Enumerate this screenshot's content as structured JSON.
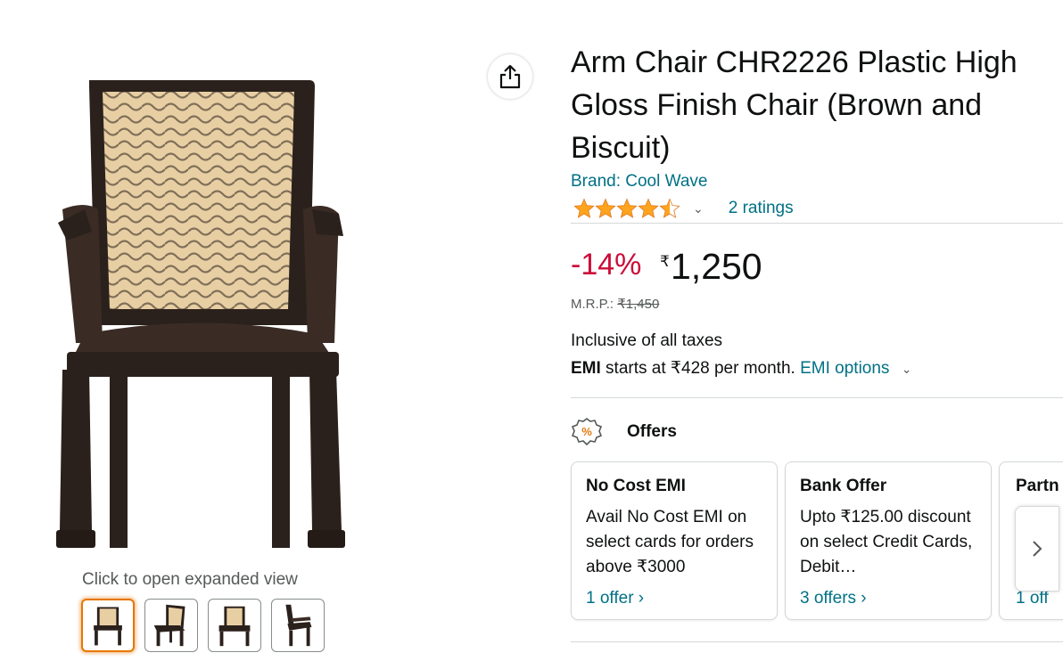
{
  "gallery": {
    "expand_text": "Click to open expanded view",
    "thumbnails": [
      "front-view",
      "angle-view",
      "front-view-2",
      "side-view"
    ],
    "selected_index": 0
  },
  "product": {
    "title": "Arm Chair CHR2226 Plastic High Gloss Finish Chair (Brown and Biscuit)",
    "brand": "Brand: Cool Wave",
    "rating_stars": 4.5,
    "ratings_text": "2 ratings",
    "discount": "-14%",
    "currency": "₹",
    "price": "1,250",
    "mrp_label": "M.R.P.: ",
    "mrp_value": "₹1,450",
    "tax_text": "Inclusive of all taxes",
    "emi_label": "EMI",
    "emi_text": " starts at ₹428 per month. ",
    "emi_options": "EMI options"
  },
  "offers": {
    "title": "Offers",
    "cards": [
      {
        "title": "No Cost EMI",
        "desc": "Avail No Cost EMI on select cards for orders above ₹3000",
        "link": "1 offer ›"
      },
      {
        "title": "Bank Offer",
        "desc": "Upto ₹125.00 discount on select Credit Cards, Debit…",
        "link": "3 offers ›"
      },
      {
        "title": "Partn",
        "desc": "",
        "link": "1 off"
      }
    ]
  },
  "colors": {
    "link": "#007185",
    "discount": "#cc0c39",
    "chair_dark": "#2b211c",
    "chair_light": "#e8cfa3",
    "star": "#ffa41c"
  }
}
